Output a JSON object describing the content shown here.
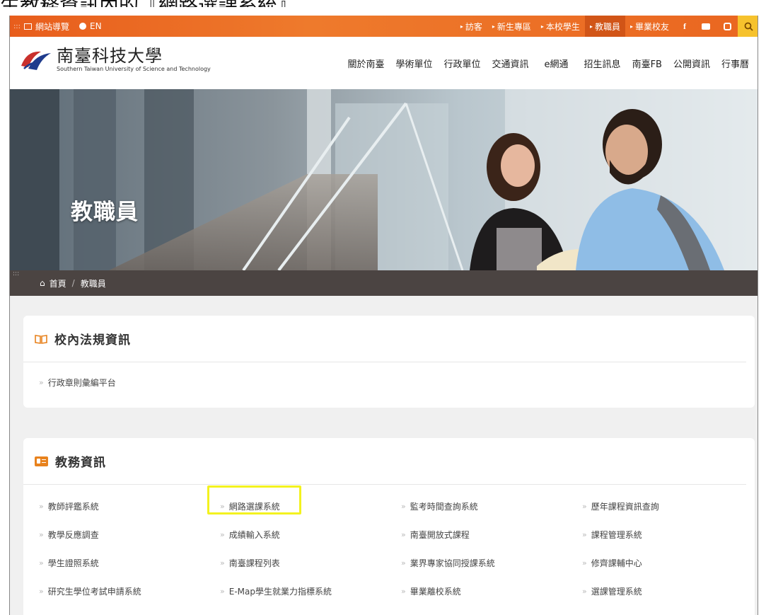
{
  "caption": "生教務資訊內的『網路選課系統』",
  "topbar": {
    "sitemap": "網站導覽",
    "lang": "EN",
    "quick_links": [
      "訪客",
      "新生專區",
      "本校學生",
      "教職員",
      "畢業校友"
    ],
    "social": [
      "facebook-icon",
      "youtube-icon",
      "instagram-icon"
    ]
  },
  "header": {
    "logo_zh": "南臺科技大學",
    "logo_en": "Southern Taiwan University of Science and Technology",
    "nav": [
      "關於南臺",
      "學術單位",
      "行政單位",
      "交通資訊",
      "e網通",
      "招生訊息",
      "南臺FB",
      "公開資訊",
      "行事曆"
    ]
  },
  "banner": {
    "title": "教職員"
  },
  "breadcrumb": {
    "home": "首頁",
    "current": "教職員"
  },
  "card1": {
    "title": "校內法規資訊",
    "links": [
      "行政章則彙編平台"
    ]
  },
  "card2": {
    "title": "教務資訊",
    "links": [
      "教師評鑑系統",
      "網路選課系統",
      "監考時間查詢系統",
      "歷年課程資訊查詢",
      "教學反應調查",
      "成績輸入系統",
      "南臺開放式課程",
      "課程管理系統",
      "學生證照系統",
      "南臺課程列表",
      "業界專家協同授課系統",
      "修齊課輔中心",
      "研究生學位考試申請系統",
      "E-Map學生就業力指標系統",
      "畢業離校系統",
      "選課管理系統"
    ]
  },
  "colors": {
    "topbar": "#e85d1c",
    "active_quick": "#b83a08",
    "search_bg": "#f6c22d",
    "breadcrumb_bg": "#4b4442",
    "highlight": "#f3f21f"
  }
}
